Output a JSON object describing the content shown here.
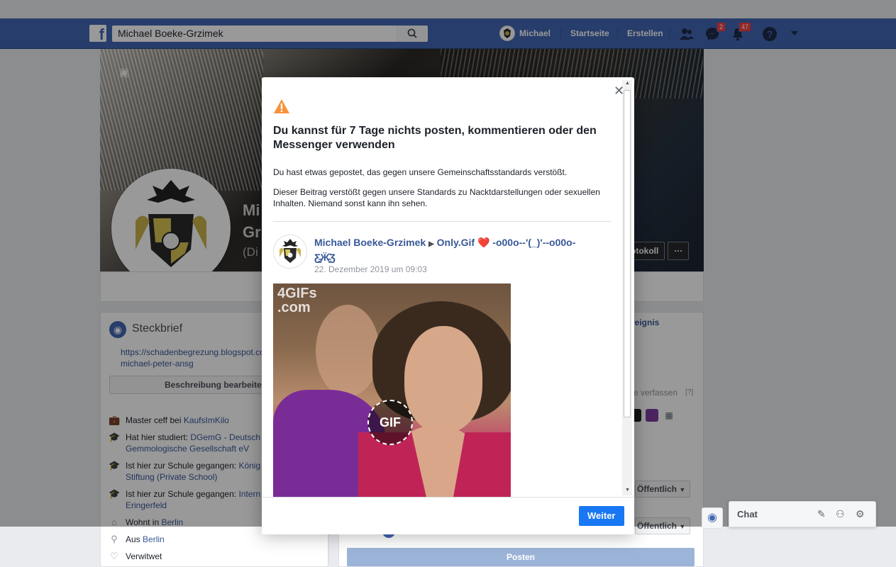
{
  "navbar": {
    "logo": "f",
    "search_value": "Michael Boeke-Grzimek",
    "user_name": "Michael",
    "home": "Startseite",
    "create": "Erstellen",
    "messages_badge": "2",
    "notifications_badge": "47"
  },
  "profile": {
    "name_line1": "Mi",
    "name_line2": "Gr",
    "name_line3": "(Di",
    "cover_button": "otokoll",
    "more": "···"
  },
  "intro": {
    "title": "Steckbrief",
    "url": "https://schadenbegrezung.blogspot.co /kaufsimkilo-michael-peter-ansg",
    "edit_button": "Beschreibung bearbeiten",
    "items": [
      {
        "prefix": "Master ceff bei ",
        "link": "KaufsImKilo",
        "suffix": ""
      },
      {
        "prefix": "Hat hier studiert: ",
        "link": "DGemG - Deutsch",
        "suffix": "",
        "line2": "Gemmologische Gesellschaft eV"
      },
      {
        "prefix": "Ist hier zur Schule gegangen: ",
        "link": "König",
        "suffix": "",
        "line2": "Stiftung (Private School)"
      },
      {
        "prefix": "Ist hier zur Schule gegangen: ",
        "link": "Intern",
        "suffix": "",
        "line2": "Eringerfeld"
      },
      {
        "prefix": "Wohnt in ",
        "link": "Berlin",
        "suffix": ""
      },
      {
        "prefix": "Aus ",
        "link": "Berlin",
        "suffix": ""
      },
      {
        "prefix": "Verwitwet",
        "link": "",
        "suffix": ""
      }
    ]
  },
  "composer": {
    "ereignis": "reignis",
    "verfassen": "e verfassen",
    "help": "[?]",
    "audience1": "Öffentlich",
    "audience2": "Öffentlich",
    "post_button": "Posten"
  },
  "chat": {
    "label": "Chat"
  },
  "dialog": {
    "title": "Du kannst für 7 Tage nichts posten, kommentieren oder den Messenger verwenden",
    "p1": "Du hast etwas gepostet, das gegen unsere Gemeinschaftsstandards verstößt.",
    "p2": "Dieser Beitrag verstößt gegen unsere Standards zu Nacktdarstellungen oder sexuellen Inhalten. Niemand sonst kann ihn sehen.",
    "post": {
      "author": "Michael Boeke-Grzimek",
      "target": "Only.Gif",
      "target_suffix": "-o00o--'(_)'--o00o-",
      "target_line2": "Ƹ̵̡Ӝ̵̨̄Ʒ",
      "date": "22. Dezember 2019 um 09:03",
      "watermark_line1": "4GIFs",
      "watermark_line2": ".com",
      "gif_label": "GIF"
    },
    "continue_button": "Weiter"
  },
  "colors": {
    "navbar": "#4267b2",
    "primary_button": "#1877f2",
    "warning": "#f7923b",
    "link": "#385898"
  }
}
